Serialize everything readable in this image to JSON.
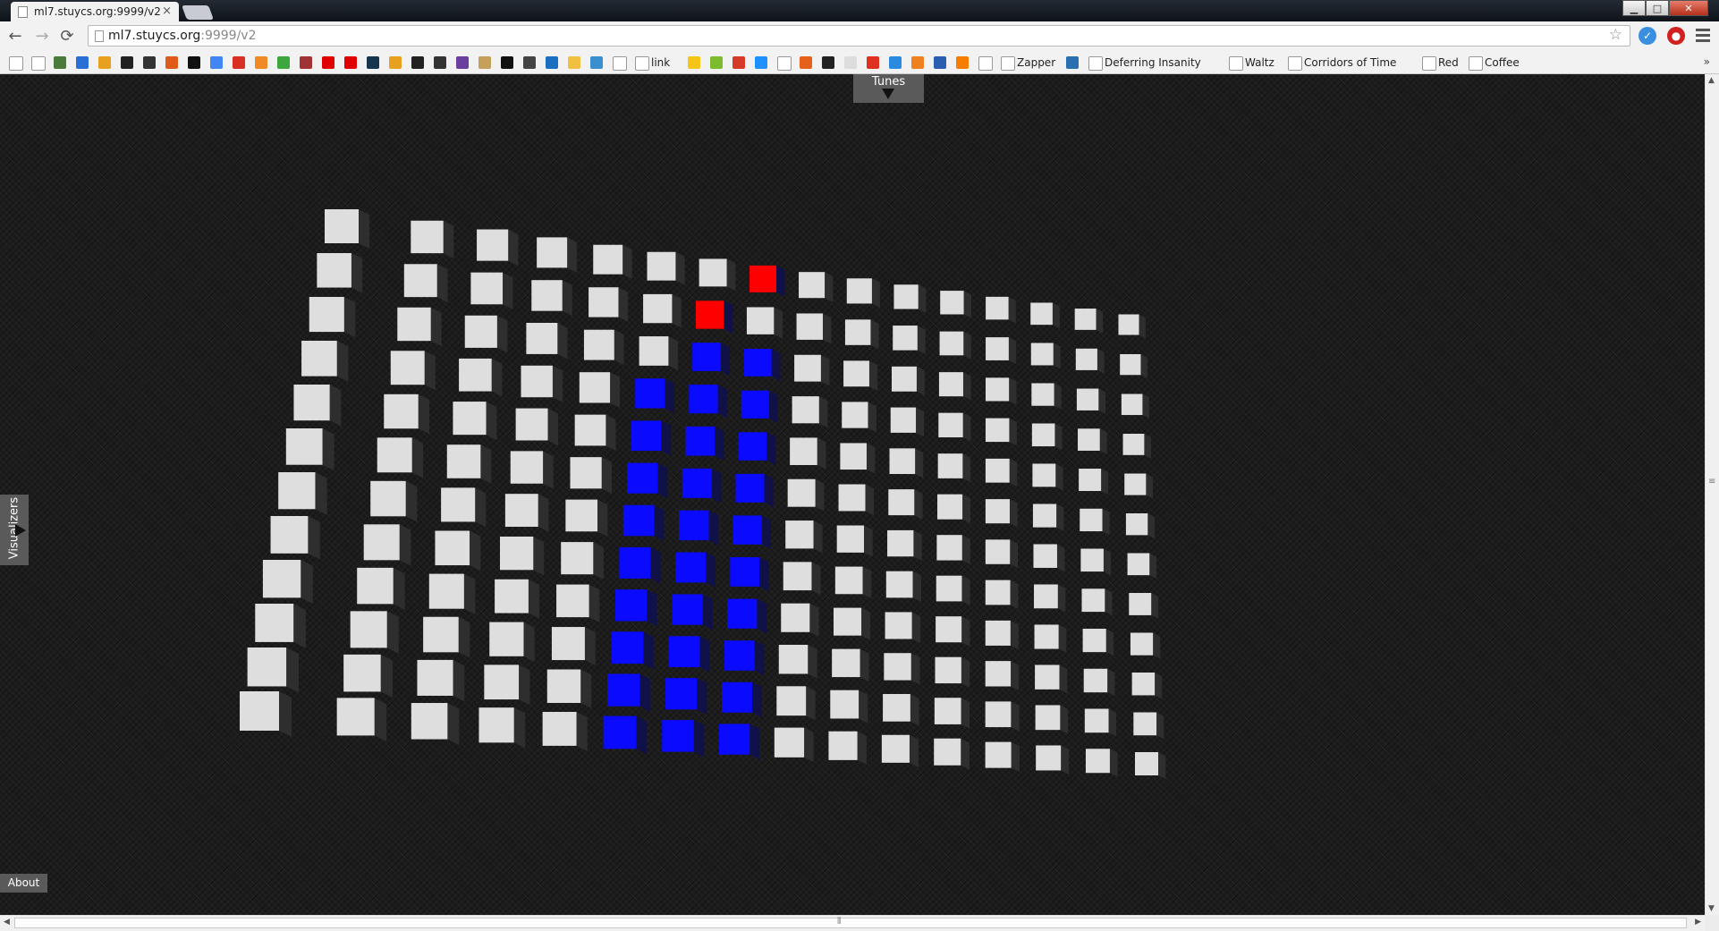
{
  "browser": {
    "tab_title": "ml7.stuycs.org:9999/v2",
    "tab_close": "×",
    "window_buttons": {
      "minimize": "▁",
      "maximize": "□",
      "close": "✕"
    },
    "url_host": "ml7.stuycs.org",
    "url_rest": ":9999/v2",
    "back": "←",
    "forward": "→",
    "reload": "⟳",
    "star": "☆",
    "bookmarks_overflow": "»"
  },
  "bookmarks": [
    {
      "label": "",
      "icon": "page-icon",
      "color": "#ffffff"
    },
    {
      "label": "",
      "icon": "page-icon",
      "color": "#ffffff"
    },
    {
      "label": "",
      "icon": "image-icon",
      "color": "#4a7b3a"
    },
    {
      "label": "",
      "icon": "calendar-icon",
      "color": "#2a6fd6"
    },
    {
      "label": "",
      "icon": "chart-icon",
      "color": "#e8a020"
    },
    {
      "label": "",
      "icon": "hacker-icon",
      "color": "#222222"
    },
    {
      "label": "",
      "icon": "github-icon",
      "color": "#333333"
    },
    {
      "label": "",
      "icon": "sourceforge-icon",
      "color": "#e05a1a"
    },
    {
      "label": "",
      "icon": "nyt-icon",
      "color": "#111111"
    },
    {
      "label": "",
      "icon": "google-icon",
      "color": "#4285f4"
    },
    {
      "label": "",
      "icon": "gmail-icon",
      "color": "#d93025"
    },
    {
      "label": "",
      "icon": "chart-orange-icon",
      "color": "#f08a24"
    },
    {
      "label": "",
      "icon": "green-icon",
      "color": "#3da63d"
    },
    {
      "label": "",
      "icon": "book-icon",
      "color": "#a03333"
    },
    {
      "label": "",
      "icon": "youtube-icon",
      "color": "#e00000"
    },
    {
      "label": "",
      "icon": "youtube-icon",
      "color": "#e00000"
    },
    {
      "label": "",
      "icon": "snowflake-icon",
      "color": "#16364f"
    },
    {
      "label": "",
      "icon": "hr-icon",
      "color": "#e8a020"
    },
    {
      "label": "",
      "icon": "quote-icon",
      "color": "#222222"
    },
    {
      "label": "",
      "icon": "qr-icon",
      "color": "#333333"
    },
    {
      "label": "",
      "icon": "dragon-icon",
      "color": "#6b3fa0"
    },
    {
      "label": "",
      "icon": "bottle-icon",
      "color": "#c4a05a"
    },
    {
      "label": "",
      "icon": "z-icon",
      "color": "#111111"
    },
    {
      "label": "",
      "icon": "printer-icon",
      "color": "#444444"
    },
    {
      "label": "",
      "icon": "app-icon",
      "color": "#1a6fc0"
    },
    {
      "label": "",
      "icon": "note-icon",
      "color": "#f0c040"
    },
    {
      "label": "",
      "icon": "photo-icon",
      "color": "#3a8fd0"
    },
    {
      "label": "",
      "icon": "wikipedia-icon",
      "color": "#ffffff"
    },
    {
      "label": "link",
      "icon": "page-icon",
      "color": "#ffffff"
    },
    {
      "label": "",
      "icon": "lemon-icon",
      "color": "#f5c518"
    },
    {
      "label": "",
      "icon": "leaf-icon",
      "color": "#7dbb2f"
    },
    {
      "label": "",
      "icon": "tomato-icon",
      "color": "#d83a2a"
    },
    {
      "label": "",
      "icon": "blue-app-icon",
      "color": "#1e90ff"
    },
    {
      "label": "",
      "icon": "page-icon",
      "color": "#ffffff"
    },
    {
      "label": "",
      "icon": "play-icon",
      "color": "#e5601a"
    },
    {
      "label": "",
      "icon": "s-icon",
      "color": "#222222"
    },
    {
      "label": "",
      "icon": "phone-icon",
      "color": "#dddddd"
    },
    {
      "label": "",
      "icon": "bug-icon",
      "color": "#e03020"
    },
    {
      "label": "",
      "icon": "dropbox-icon",
      "color": "#2a8ae0"
    },
    {
      "label": "",
      "icon": "u-icon",
      "color": "#f08020"
    },
    {
      "label": "",
      "icon": "home-icon",
      "color": "#2a5fb0"
    },
    {
      "label": "",
      "icon": "blogger-icon",
      "color": "#f57d00"
    },
    {
      "label": "",
      "icon": "page-icon",
      "color": "#ffffff"
    },
    {
      "label": "Zapper",
      "icon": "page-icon",
      "color": "#ffffff"
    },
    {
      "label": "",
      "icon": "drop-icon",
      "color": "#2a6fb0"
    },
    {
      "label": "Deferring Insanity",
      "icon": "page-icon",
      "color": "#ffffff"
    },
    {
      "label": "Waltz",
      "icon": "clock-icon",
      "color": "#ffffff"
    },
    {
      "label": "Corridors of Time",
      "icon": "page-icon",
      "color": "#ffffff"
    },
    {
      "label": "Red",
      "icon": "clock-icon",
      "color": "#ffffff"
    },
    {
      "label": "Coffee",
      "icon": "page-icon",
      "color": "#ffffff"
    }
  ],
  "page": {
    "tunes_label": "Tunes",
    "visualizers_label": "Visualizers",
    "about_label": "About"
  },
  "visualizer": {
    "colors": {
      "idle": "#dedede",
      "bar": "#0a0aff",
      "peak": "#ff0000"
    },
    "columns": 16,
    "rows": 12,
    "bar_heights": [
      0,
      0,
      0,
      0,
      0,
      9,
      10,
      10,
      0,
      0,
      0,
      0,
      0,
      0,
      0,
      0
    ],
    "peaks": [
      0,
      0,
      0,
      0,
      0,
      0,
      11,
      12,
      0,
      0,
      0,
      0,
      0,
      0,
      0,
      0
    ]
  }
}
